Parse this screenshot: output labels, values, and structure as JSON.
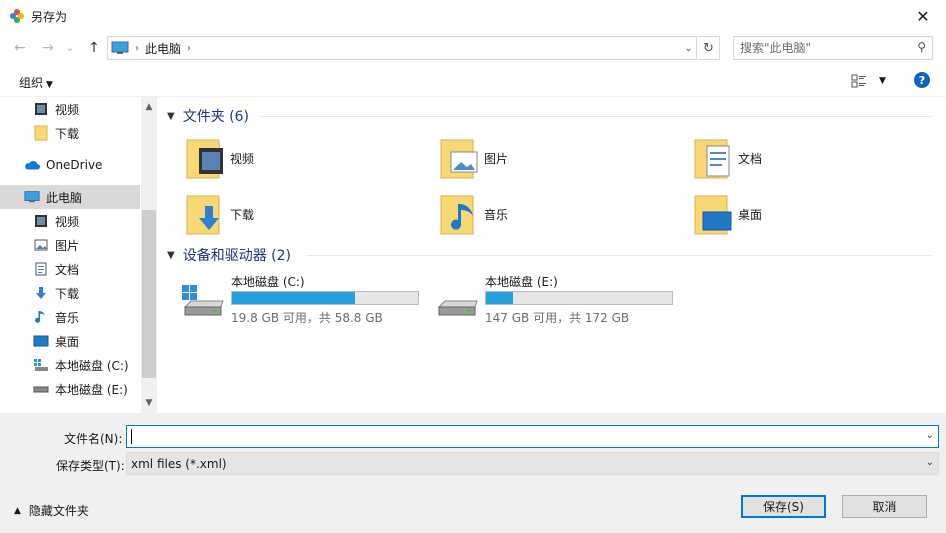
{
  "window": {
    "title": "另存为",
    "close_glyph": "✕"
  },
  "nav": {
    "back_glyph": "←",
    "forward_glyph": "→",
    "recent_glyph": "⌄",
    "up_glyph": "↑",
    "breadcrumb": [
      "此电脑"
    ],
    "refresh_glyph": "↻",
    "search_placeholder": "搜索\"此电脑\""
  },
  "toolbar": {
    "organize_label": "组织",
    "help_label": "?"
  },
  "sidebar": {
    "items": [
      {
        "label": "视频",
        "icon": "video-icon"
      },
      {
        "label": "下载",
        "icon": "folder-icon"
      },
      {
        "label": "OneDrive",
        "icon": "cloud-icon"
      },
      {
        "label": "此电脑",
        "icon": "computer-icon",
        "selected": true
      },
      {
        "label": "视频",
        "icon": "video-icon"
      },
      {
        "label": "图片",
        "icon": "picture-icon"
      },
      {
        "label": "文档",
        "icon": "document-icon"
      },
      {
        "label": "下载",
        "icon": "download-icon"
      },
      {
        "label": "音乐",
        "icon": "music-icon"
      },
      {
        "label": "桌面",
        "icon": "desktop-icon"
      },
      {
        "label": "本地磁盘 (C:)",
        "icon": "drive-c-icon"
      },
      {
        "label": "本地磁盘 (E:)",
        "icon": "drive-icon"
      }
    ]
  },
  "content": {
    "folders_header": "文件夹 (6)",
    "folders": [
      {
        "label": "视频",
        "icon": "video-folder-icon"
      },
      {
        "label": "图片",
        "icon": "picture-folder-icon"
      },
      {
        "label": "文档",
        "icon": "document-folder-icon"
      },
      {
        "label": "下载",
        "icon": "download-folder-icon"
      },
      {
        "label": "音乐",
        "icon": "music-folder-icon"
      },
      {
        "label": "桌面",
        "icon": "desktop-folder-icon"
      }
    ],
    "devices_header": "设备和驱动器 (2)",
    "drives": [
      {
        "name": "本地磁盘 (C:)",
        "size_text": "19.8 GB 可用，共 58.8 GB",
        "used_fraction": 0.663,
        "icon": "windows-drive-icon"
      },
      {
        "name": "本地磁盘 (E:)",
        "size_text": "147 GB 可用，共 172 GB",
        "used_fraction": 0.145,
        "icon": "hard-drive-icon"
      }
    ]
  },
  "form": {
    "filename_label": "文件名(N):",
    "filename_value": "",
    "filetype_label": "保存类型(T):",
    "filetype_value": "xml files (*.xml)",
    "hide_folders_label": "隐藏文件夹",
    "save_label": "保存(S)",
    "cancel_label": "取消"
  },
  "colors": {
    "accent": "#0078d7",
    "bar_fill": "#26a0da",
    "folder": "#f8d775",
    "header_text": "#1e3287"
  }
}
